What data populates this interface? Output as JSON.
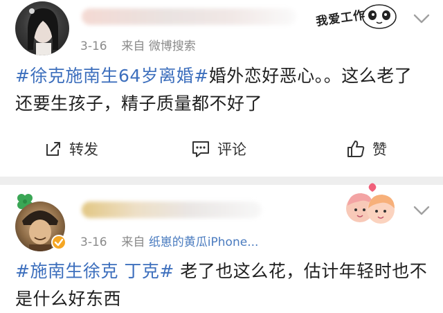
{
  "posts": [
    {
      "author_name": "",
      "date": "3-16",
      "source_prefix": "来自",
      "source_name": "微博搜索",
      "hashtag": "#徐克施南生64岁离婚#",
      "text": "婚外恋好恶心。。这么老了还要生孩子，精子质量都不好了",
      "sticker_text": "我爱工作",
      "actions": {
        "repost": "转发",
        "comment": "评论",
        "like": "赞"
      }
    },
    {
      "author_name": "",
      "date": "3-16",
      "source_prefix": "来自",
      "source_name": "纸崽的黄瓜iPhone...",
      "hashtag": "#施南生徐克 丁克#",
      "text": " 老了也这么花，估计年轻时也不是什么好东西"
    }
  ],
  "colors": {
    "link": "#3d6fbd",
    "meta": "#8a8a8a",
    "divider": "#eeeeee",
    "verified": "#f5a623"
  },
  "icons": [
    "repost-icon",
    "comment-icon",
    "like-icon",
    "chevron-down-icon",
    "clover-icon",
    "verified-badge-icon",
    "couple-sticker-icon",
    "panda-sticker-icon"
  ]
}
